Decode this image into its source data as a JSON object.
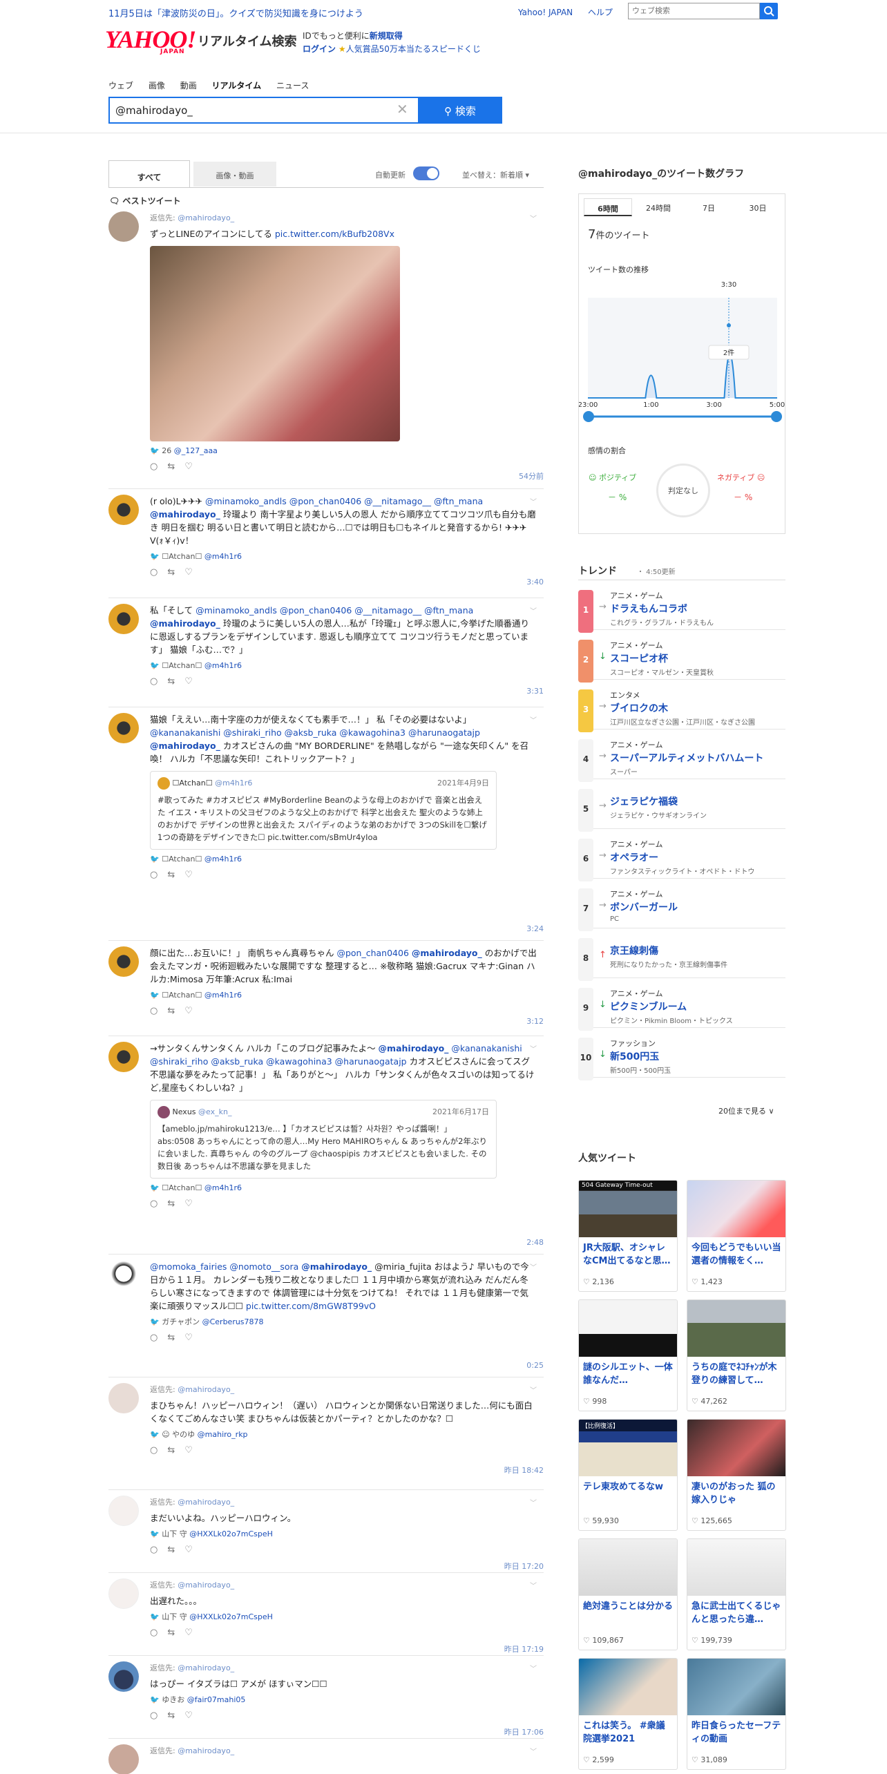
{
  "header": {
    "announcement": "11月5日は「津波防災の日」。クイズで防災知識を身につけよう",
    "links": [
      "Yahoo! JAPAN",
      "ヘルプ"
    ],
    "web_search_placeholder": "ウェブ検索",
    "logo_text": "YAHOO!",
    "logo_sub": "JAPAN",
    "service_name": "リアルタイム検索",
    "id_line1_prefix": "IDでもっと便利に",
    "id_line1_link": "新規取得",
    "id_line2_link": "ログイン",
    "id_line2_text": "人気賞品50万本当たるスピードくじ",
    "nav": [
      "ウェブ",
      "画像",
      "動画",
      "リアルタイム",
      "ニュース"
    ],
    "query": "@mahirodayo_",
    "search_button": "検索"
  },
  "tabs": {
    "all": "すべて",
    "media": "画像・動画",
    "auto_update": "自動更新",
    "sort": "並べ替え：新着順 ▾",
    "best": "ベストツイート"
  },
  "tweets": [
    {
      "reply_prefix": "返信先:",
      "reply_to": "@mahirodayo_",
      "text": "ずっとLINEのアイコンにしてる ",
      "link": "pic.twitter.com/kBufb208Vx",
      "meta_count": "26",
      "meta_user": "@_127_aaa",
      "time": "54分前"
    },
    {
      "text_a": "(r olo)L✈✈✈ ",
      "mentions_a": "@minamoko_andls @pon_chan0406 @__nitamago__ @ftn_mana",
      "bold": "@mahirodayo_",
      "text_b": " 玲瓏より 南十字星より美しい5人の恩人 だから順序立ててコツコツ爪も自分も磨き 明日を掴む 明るい日と書いて明日と読むから…☐では明日も☐もネイルと発音するから! ✈✈✈V(ｫ￥ｨ)v！",
      "meta_user_name": "☐Atchan☐",
      "meta_user": "@m4h1r6",
      "time": "3:40"
    },
    {
      "text_a": "私「そして ",
      "mentions_a": "@minamoko_andls @pon_chan0406 @__nitamago__ @ftn_mana",
      "bold": "@mahirodayo_",
      "text_b": " 玲瓏のように美しい5人の恩人…私が「玲瓏ｪ」と呼ぶ恩人に,今挙げた順番通りに恩返しするプランをデザインしています. 恩返しも順序立てて コツコツ行うモノだと思っています」 猫娘「ふむ…で？」",
      "meta_user_name": "☐Atchan☐",
      "meta_user": "@m4h1r6",
      "time": "3:31"
    },
    {
      "text_a": "猫娘「ええい…南十字座の力が使えなくても素手で…！」 私「その必要はないよ」 ",
      "mentions_a": "@kananakanishi @shiraki_riho @aksb_ruka @kawagohina3 @harunaogatajp",
      "bold": "@mahirodayo_",
      "text_b": " カオスビさんの曲 \"MY BORDERLINE\" を熱唱しながら \"一途な矢印くん\" を召喚！ ハルカ「不思議な矢印！これトリックアート？」",
      "quote_user": "☐Atchan☐",
      "quote_handle": "@m4h1r6",
      "quote_date": "2021年4月9日",
      "quote_text": "#歌ってみた #カオスピピス #MyBorderline Beanのような母上のおかげで 音楽と出会えた イエス・キリストの父ヨゼフのような父上のおかげで 科学と出会えた 聖火のような姉上のおかげで デザインの世界と出会えた スパイディのような弟のおかげで 3つのSkillを☐繋げ 1つの奇跡をデザインできた☐ pic.twitter.com/sBmUr4yIoa",
      "meta_user_name": "☐Atchan☐",
      "meta_user": "@m4h1r6",
      "time": "3:24"
    },
    {
      "text_a": "顔に出た…お互いに！」 南帆ちゃん真尋ちゃん ",
      "mentions_a": "@pon_chan0406",
      "bold": "@mahirodayo_",
      "text_b": " のおかげで出会えたマンガ・呪術廻戦みたいな展開ですな 整理すると… ※敬称略 猫娘:Gacrux マキナ:Ginan ハルカ:Mimosa 万年筆:Acrux 私:Imai",
      "meta_user_name": "☐Atchan☐",
      "meta_user": "@m4h1r6",
      "time": "3:12"
    },
    {
      "text_a": "→サンタくんサンタくん ハルカ「このブログ記事みたよ〜 ",
      "bold": "@mahirodayo_",
      "mentions_a": "@kananakanishi @shiraki_riho @aksb_ruka @kawagohina3 @harunaogatajp",
      "text_b": " カオスビピスさんに会ってスグ不思議な夢をみたって記事！」 私「ありがと〜」 ハルカ「サンタくんが色々スゴいのは知ってるけど,星座もくわしいね？」",
      "quote_user": "Nexus",
      "quote_handle": "@ex_kn_",
      "quote_date": "2021年6月17日",
      "quote_text": "【ameblo.jp/mahiroku1213/e… 】「カオスビピスは皙？사차원？やっぱ醬唎！」 abs:0508 あっちゃんにとって命の恩人…My Hero MAHIROちゃん & あっちゃんが2年ぶりに会いました. 真尋ちゃん の今のグループ @chaospipis カオスビピスとも会いました. その数日後 あっちゃんは不思議な夢を見ました",
      "meta_user_name": "☐Atchan☐",
      "meta_user": "@m4h1r6",
      "time": "2:48"
    },
    {
      "mentions_a": "@momoka_fairies @nomoto__sora",
      "bold": "@mahirodayo_",
      "text_b": " @miria_fujita おはよう♪ 早いもので今日から１１月。 カレンダーも残り二枚となりました☐ １１月中頃から寒気が流れ込み だんだん冬らしい寒さになってきますので 体調管理には十分気をつけてね！ それでは １１月も健康第一で気楽に頑張りマッスル☐☐ ",
      "link": "pic.twitter.com/8mGW8T99vO",
      "meta_user_name": "ガチャポン",
      "meta_user": "@Cerberus7878",
      "time": "0:25"
    },
    {
      "reply_prefix": "返信先:",
      "reply_to": "@mahirodayo_",
      "text": "まひちゃん！ハッピーハロウィン！（遅い） ハロウィンとか関係ない日常送りました…何にも面白くなくてごめんなさい笑 まひちゃんは仮装とかパーティ？とかしたのかな？☐",
      "meta_user_name": "☺ やのゆ",
      "meta_user": "@mahiro_rkp",
      "time": "昨日 18:42"
    },
    {
      "reply_prefix": "返信先:",
      "reply_to": "@mahirodayo_",
      "text": "まだいいよね。ハッピーハロウィン。",
      "meta_user_name": "山下 守",
      "meta_user": "@HXXLk02o7mCspeH",
      "time": "昨日 17:20"
    },
    {
      "reply_prefix": "返信先:",
      "reply_to": "@mahirodayo_",
      "text": "出遅れた。。。",
      "meta_user_name": "山下 守",
      "meta_user": "@HXXLk02o7mCspeH",
      "time": "昨日 17:19"
    },
    {
      "reply_prefix": "返信先:",
      "reply_to": "@mahirodayo_",
      "text": "はっぴー イタズラは☐ アメが ほすぃマン☐☐",
      "meta_user_name": "ゆきお",
      "meta_user": "@fair07mahi05",
      "time": "昨日 17:06"
    },
    {
      "reply_prefix": "返信先:",
      "reply_to": "@mahirodayo_",
      "text": ""
    }
  ],
  "graph": {
    "title": "@mahirodayo_のツイート数グラフ",
    "tabs": [
      "6時間",
      "24時間",
      "7日",
      "30日"
    ],
    "count_num": "7",
    "count_label": "件のツイート",
    "trend_label": "ツイート数の推移",
    "peak_time": "3:30",
    "tooltip": "2件",
    "x_labels": [
      "23:00",
      "1:00",
      "3:00",
      "5:00"
    ],
    "emotion_label": "感情の割合",
    "positive": "ポジティブ",
    "negative": "ネガティブ",
    "pos_value": "－ %",
    "neg_value": "－ %",
    "judge": "判定なし"
  },
  "chart_data": {
    "type": "area",
    "x": [
      "23:00",
      "1:00",
      "3:00",
      "3:30",
      "5:00"
    ],
    "xlabel": "",
    "ylabel": "",
    "note_peak": "3:30",
    "series": [
      {
        "values": [
          0,
          1,
          0,
          2,
          0
        ]
      }
    ]
  },
  "trends": {
    "title": "トレンド",
    "updated": "・ 4:50更新",
    "items": [
      {
        "rank": "1",
        "cat": "アニメ・ゲーム",
        "name": "ドラえもんコラボ",
        "sub": "これグラ・グラブル・ドラえもん",
        "arrow": "→",
        "color": "#ef6f7e"
      },
      {
        "rank": "2",
        "cat": "アニメ・ゲーム",
        "name": "スコーピオ杯",
        "sub": "スコーピオ・マルゼン・天皇賞秋",
        "arrow": "↓",
        "color": "#f0906a"
      },
      {
        "rank": "3",
        "cat": "エンタメ",
        "name": "ブイロクの木",
        "sub": "江戸川区立なぎさ公園・江戸川区・なぎさ公園",
        "arrow": "→",
        "color": "#f5c842"
      },
      {
        "rank": "4",
        "cat": "アニメ・ゲーム",
        "name": "スーパーアルティメットバハムート",
        "sub": "スーパー",
        "arrow": "→",
        "color": ""
      },
      {
        "rank": "5",
        "cat": "",
        "name": "ジェラピケ福袋",
        "sub": "ジェラピケ・ウサギオンライン",
        "arrow": "→",
        "color": ""
      },
      {
        "rank": "6",
        "cat": "アニメ・ゲーム",
        "name": "オペラオー",
        "sub": "ファンタスティックライト・オペドト・ドトウ",
        "arrow": "→",
        "color": ""
      },
      {
        "rank": "7",
        "cat": "アニメ・ゲーム",
        "name": "ボンバーガール",
        "sub": "PC",
        "arrow": "→",
        "color": ""
      },
      {
        "rank": "8",
        "cat": "",
        "name": "京王線刺傷",
        "sub": "死刑になりたかった・京王線刺傷事件",
        "arrow": "↑",
        "color": ""
      },
      {
        "rank": "9",
        "cat": "アニメ・ゲーム",
        "name": "ピクミンブルーム",
        "sub": "ピクミン・Pikmin Bloom・トピックス",
        "arrow": "↓",
        "color": ""
      },
      {
        "rank": "10",
        "cat": "ファッション",
        "name": "新500円玉",
        "sub": "新500円・500円玉",
        "arrow": "↓",
        "color": ""
      }
    ],
    "more": "20位まで見る ∨"
  },
  "popular": {
    "title": "人気ツイート",
    "cards": [
      {
        "text": "JR大阪駅、オシャレなCM出てるなと思…",
        "likes": "2,136",
        "img_caption": "504 Gateway Time-out"
      },
      {
        "text": "今回もどうでもいい当選者の情報をく…",
        "likes": "1,423",
        "img_caption": ""
      },
      {
        "text": "謎のシルエット、一体誰なんだ…",
        "likes": "998",
        "img_caption": ""
      },
      {
        "text": "うちの庭でﾈｺﾁｬﾝが木登りの練習して…",
        "likes": "47,262",
        "img_caption": ""
      },
      {
        "text": "テレ東攻めてるなw",
        "likes": "59,930",
        "img_caption": "【比例復活】"
      },
      {
        "text": "凄いのがおった 狐の嫁入りじゃ",
        "likes": "125,665",
        "img_caption": ""
      },
      {
        "text": "絶対違うことは分かる",
        "likes": "109,867",
        "img_caption": ""
      },
      {
        "text": "急に武士出てくるじゃんと思ったら違…",
        "likes": "199,739",
        "img_caption": ""
      },
      {
        "text": "これは笑う。 #衆議院選挙2021",
        "likes": "2,599",
        "img_caption": ""
      },
      {
        "text": "昨日食らったセーフティの動画",
        "likes": "31,089",
        "img_caption": ""
      }
    ]
  },
  "colors": {
    "accent": "#1a73e8",
    "link": "#1a4eb8",
    "brand": "#ff0033"
  }
}
